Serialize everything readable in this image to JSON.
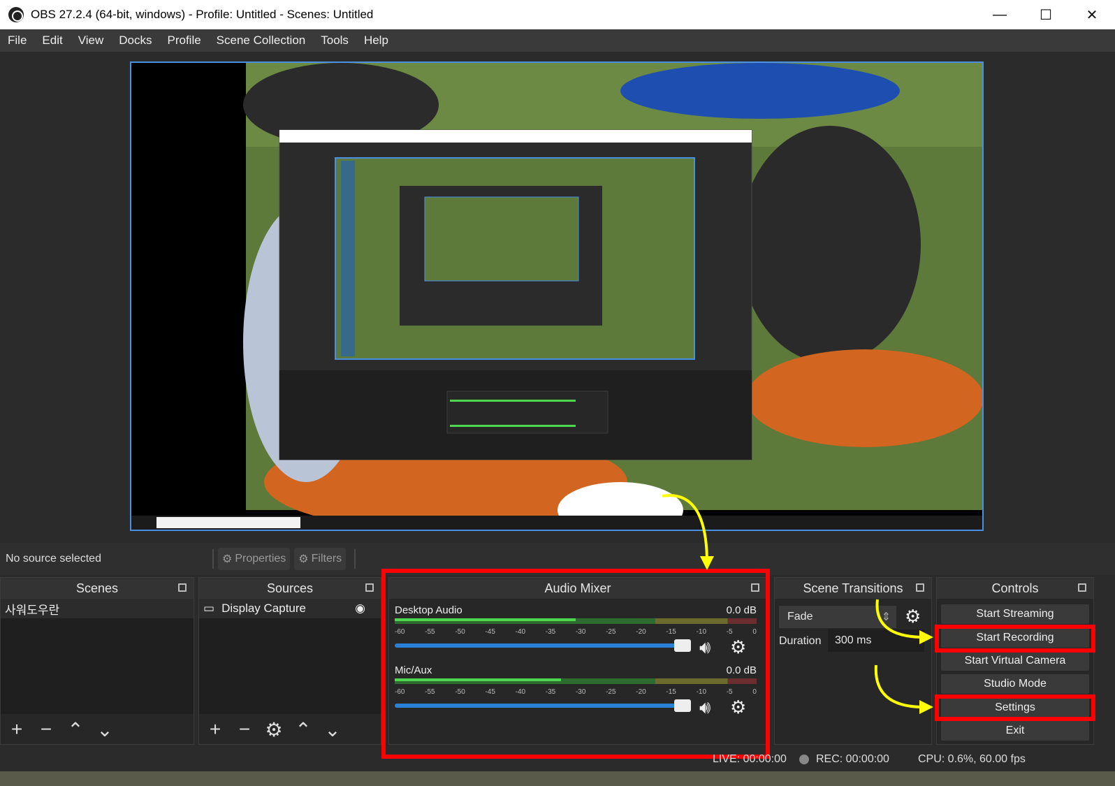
{
  "window": {
    "title": "OBS 27.2.4 (64-bit, windows) - Profile: Untitled - Scenes: Untitled",
    "minimize": "—",
    "maximize": "☐",
    "close": "✕"
  },
  "menu": [
    "File",
    "Edit",
    "View",
    "Docks",
    "Profile",
    "Scene Collection",
    "Tools",
    "Help"
  ],
  "source_toolbar": {
    "no_source": "No source selected",
    "properties": "Properties",
    "filters": "Filters"
  },
  "scenes": {
    "header": "Scenes",
    "items": [
      "사워도우란"
    ]
  },
  "sources": {
    "header": "Sources",
    "items": [
      "Display Capture"
    ]
  },
  "audio_mixer": {
    "header": "Audio Mixer",
    "channels": [
      {
        "name": "Desktop Audio",
        "db": "0.0 dB",
        "level": 0.5
      },
      {
        "name": "Mic/Aux",
        "db": "0.0 dB",
        "level": 0.46
      }
    ],
    "ticks": [
      "-60",
      "-55",
      "-50",
      "-45",
      "-40",
      "-35",
      "-30",
      "-25",
      "-20",
      "-15",
      "-10",
      "-5",
      "0"
    ]
  },
  "scene_transitions": {
    "header": "Scene Transitions",
    "transition": "Fade",
    "duration_label": "Duration",
    "duration_value": "300 ms"
  },
  "controls": {
    "header": "Controls",
    "buttons": [
      "Start Streaming",
      "Start Recording",
      "Start Virtual Camera",
      "Studio Mode",
      "Settings",
      "Exit"
    ]
  },
  "status": {
    "live": "LIVE: 00:00:00",
    "rec": "REC: 00:00:00",
    "cpu": "CPU: 0.6%, 60.00 fps"
  },
  "colors": {
    "highlight_red": "#ff0000",
    "arrow_yellow": "#ffff00",
    "preview_border": "#4a90e2"
  }
}
